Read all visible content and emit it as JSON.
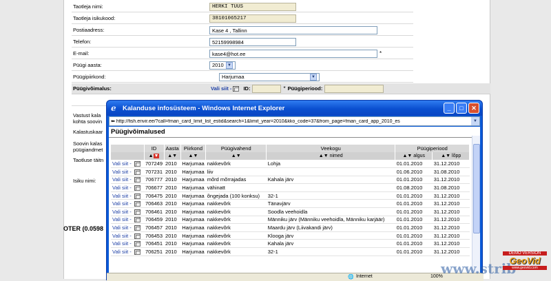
{
  "form": {
    "owner_name_label": "Taotleja nimi:",
    "owner_name_value": "HERKI TUUS",
    "owner_code_label": "Taotleja isikukood:",
    "owner_code_value": "38101065217",
    "address_label": "Postiaadress:",
    "address_value": "Kase 4 , Tallinn",
    "phone_label": "Telefon:",
    "phone_value": "52159998984",
    "email_label": "E-mail:",
    "email_value": "kase4@hot.ee",
    "year_label": "Püügi aasta:",
    "year_value": "2010",
    "region_label": "Püügipiirkond:",
    "region_value": "Harjumaa",
    "capacity_label": "Püügivõimalus:",
    "select_link": "Vali siit -",
    "id_label": "ID:",
    "period_label": "Püügiperiood:",
    "partial_1": "Vastust kala",
    "partial_1b": "kohta soovin",
    "partial_2": "Kalastuskaar",
    "partial_3": "Soovin kalas",
    "partial_3b": "püügiandmet",
    "partial_4": "Taotluse täitn",
    "partial_5": "Isiku nimi:",
    "bottom_text": "OTER (0.0598"
  },
  "popup": {
    "title": "Kalanduse infosüsteem - Windows Internet Explorer",
    "url": "http://fish.envir.ee/?call=fman_card_limit_list_estid&search=1&limit_year=2010&kko_code=37&from_page=fman_card_app_2010_es",
    "heading": "Püügivõimalused",
    "columns": {
      "id": "ID",
      "year": "Aasta",
      "region": "Piirkond",
      "gear": "Püügivahend",
      "water": "Veekogu",
      "water_sub": "nimed",
      "period": "Püügiperiood",
      "start": "algus",
      "end": "lõpp"
    },
    "rows": [
      {
        "link": "Vali siit -",
        "id": "707249",
        "year": "2010",
        "region": "Harjumaa",
        "gear": "nakkevõrk",
        "water": "Lohja",
        "start": "01.01.2010",
        "end": "31.12.2010"
      },
      {
        "link": "Vali siit -",
        "id": "707231",
        "year": "2010",
        "region": "Harjumaa",
        "gear": "liiv",
        "water": "",
        "start": "01.06.2010",
        "end": "31.08.2010"
      },
      {
        "link": "Vali siit -",
        "id": "706777",
        "year": "2010",
        "region": "Harjumaa",
        "gear": "mõrd mõrrajadas",
        "water": "Kahala järv",
        "start": "01.01.2010",
        "end": "31.12.2010"
      },
      {
        "link": "Vali siit -",
        "id": "706677",
        "year": "2010",
        "region": "Harjumaa",
        "gear": "vähinatt",
        "water": "",
        "start": "01.08.2010",
        "end": "31.08.2010"
      },
      {
        "link": "Vali siit -",
        "id": "706475",
        "year": "2010",
        "region": "Harjumaa",
        "gear": "õngejada (100 konksu)",
        "water": "32-1",
        "start": "01.01.2010",
        "end": "31.12.2010"
      },
      {
        "link": "Vali siit -",
        "id": "706463",
        "year": "2010",
        "region": "Harjumaa",
        "gear": "nakkevõrk",
        "water": "Tänavjärv",
        "start": "01.01.2010",
        "end": "31.12.2010"
      },
      {
        "link": "Vali siit -",
        "id": "706461",
        "year": "2010",
        "region": "Harjumaa",
        "gear": "nakkevõrk",
        "water": "Soodla veehoidla",
        "start": "01.01.2010",
        "end": "31.12.2010"
      },
      {
        "link": "Vali siit -",
        "id": "706459",
        "year": "2010",
        "region": "Harjumaa",
        "gear": "nakkevõrk",
        "water": "Männiku järv (Männiku veehoidla, Männiku karjäär)",
        "start": "01.01.2010",
        "end": "31.12.2010"
      },
      {
        "link": "Vali siit -",
        "id": "706457",
        "year": "2010",
        "region": "Harjumaa",
        "gear": "nakkevõrk",
        "water": "Maardu järv (Liivakandi järv)",
        "start": "01.01.2010",
        "end": "31.12.2010"
      },
      {
        "link": "Vali siit -",
        "id": "706453",
        "year": "2010",
        "region": "Harjumaa",
        "gear": "nakkevõrk",
        "water": "Klooga järv",
        "start": "01.01.2010",
        "end": "31.12.2010"
      },
      {
        "link": "Vali siit -",
        "id": "706451",
        "year": "2010",
        "region": "Harjumaa",
        "gear": "nakkevõrk",
        "water": "Kahala järv",
        "start": "01.01.2010",
        "end": "31.12.2010"
      },
      {
        "link": "Vali siit -",
        "id": "706251",
        "year": "2010",
        "region": "Harjumaa",
        "gear": "nakkevõrk",
        "water": "32-1",
        "start": "01.01.2010",
        "end": "31.12.2010"
      }
    ],
    "status_zone": "Internet",
    "status_zoom": "100%"
  },
  "watermark": "www.strib",
  "demo": {
    "line1": "DEMO VERSION",
    "line2": "GeoVid",
    "line3": "www.geovid.com"
  }
}
